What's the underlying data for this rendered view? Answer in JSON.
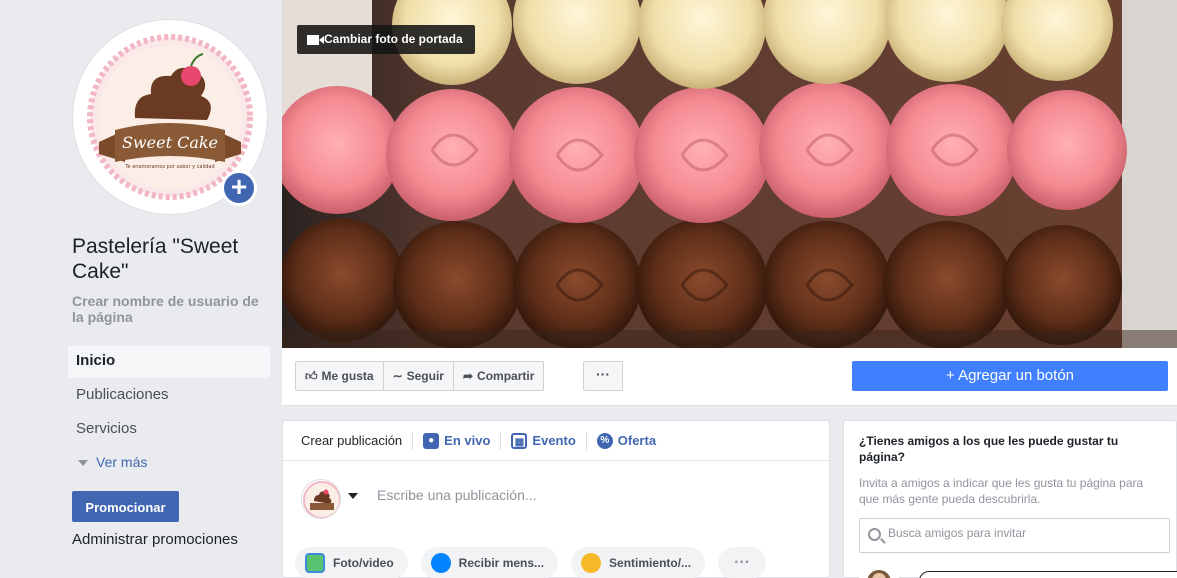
{
  "page": {
    "name": "Pastelería \"Sweet Cake\"",
    "username_prompt": "Crear nombre de usuario de la página",
    "logo_text": "Sweet Cake",
    "logo_tagline": "Te enamoramos por sabor y calidad"
  },
  "cover": {
    "change_label": "Cambiar foto de portada"
  },
  "sidebar": {
    "items": [
      {
        "label": "Inicio"
      },
      {
        "label": "Publicaciones"
      },
      {
        "label": "Servicios"
      }
    ],
    "see_more": "Ver más",
    "promote": "Promocionar",
    "manage_promotions": "Administrar promociones"
  },
  "actions": {
    "like": "Me gusta",
    "follow": "Seguir",
    "share": "Compartir",
    "more": "···",
    "add_button": "+ Agregar un botón"
  },
  "composer": {
    "tabs": [
      {
        "label": "Crear publicación"
      },
      {
        "label": "En vivo"
      },
      {
        "label": "Evento"
      },
      {
        "label": "Oferta"
      }
    ],
    "placeholder": "Escribe una publicación...",
    "pills": [
      {
        "label": "Foto/video"
      },
      {
        "label": "Recibir mens..."
      },
      {
        "label": "Sentimiento/..."
      }
    ],
    "more": "···"
  },
  "invite_card": {
    "title": "¿Tienes amigos a los que les puede gustar tu página?",
    "description": "Invita a amigos a indicar que les gusta tu página para que más gente pueda descubrirla.",
    "search_placeholder": "Busca amigos para invitar"
  },
  "colors": {
    "primary": "#4267b2",
    "add_button": "#4080ff",
    "background": "#e9ebee"
  }
}
